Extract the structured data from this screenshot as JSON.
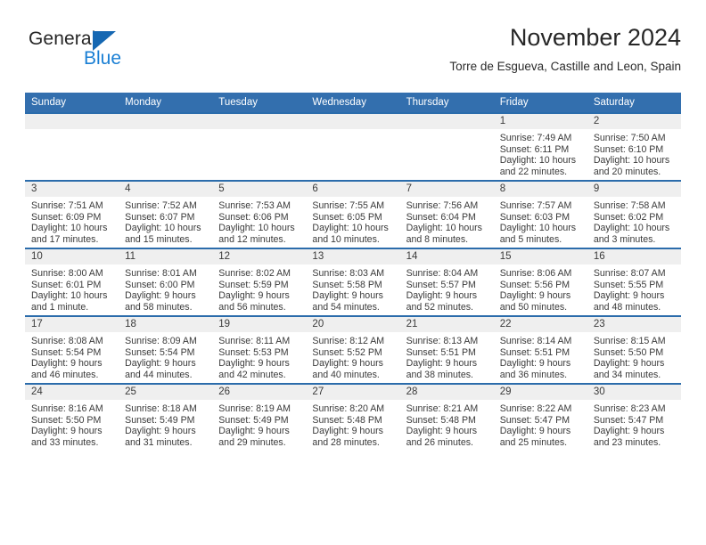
{
  "brand": {
    "line1": "General",
    "line2": "Blue",
    "triangle_color": "#1567b2",
    "blue_color": "#1a7fd4"
  },
  "header": {
    "title": "November 2024",
    "subtitle": "Torre de Esgueva, Castille and Leon, Spain"
  },
  "colors": {
    "header_bar": "#336fae",
    "row_divider": "#2b6cab",
    "daynum_band": "#efefef"
  },
  "weekdays": [
    "Sunday",
    "Monday",
    "Tuesday",
    "Wednesday",
    "Thursday",
    "Friday",
    "Saturday"
  ],
  "weeks": [
    [
      {
        "day": "",
        "blank": true
      },
      {
        "day": "",
        "blank": true
      },
      {
        "day": "",
        "blank": true
      },
      {
        "day": "",
        "blank": true
      },
      {
        "day": "",
        "blank": true
      },
      {
        "day": "1",
        "sunrise": "Sunrise: 7:49 AM",
        "sunset": "Sunset: 6:11 PM",
        "daylight": "Daylight: 10 hours and 22 minutes."
      },
      {
        "day": "2",
        "sunrise": "Sunrise: 7:50 AM",
        "sunset": "Sunset: 6:10 PM",
        "daylight": "Daylight: 10 hours and 20 minutes."
      }
    ],
    [
      {
        "day": "3",
        "sunrise": "Sunrise: 7:51 AM",
        "sunset": "Sunset: 6:09 PM",
        "daylight": "Daylight: 10 hours and 17 minutes."
      },
      {
        "day": "4",
        "sunrise": "Sunrise: 7:52 AM",
        "sunset": "Sunset: 6:07 PM",
        "daylight": "Daylight: 10 hours and 15 minutes."
      },
      {
        "day": "5",
        "sunrise": "Sunrise: 7:53 AM",
        "sunset": "Sunset: 6:06 PM",
        "daylight": "Daylight: 10 hours and 12 minutes."
      },
      {
        "day": "6",
        "sunrise": "Sunrise: 7:55 AM",
        "sunset": "Sunset: 6:05 PM",
        "daylight": "Daylight: 10 hours and 10 minutes."
      },
      {
        "day": "7",
        "sunrise": "Sunrise: 7:56 AM",
        "sunset": "Sunset: 6:04 PM",
        "daylight": "Daylight: 10 hours and 8 minutes."
      },
      {
        "day": "8",
        "sunrise": "Sunrise: 7:57 AM",
        "sunset": "Sunset: 6:03 PM",
        "daylight": "Daylight: 10 hours and 5 minutes."
      },
      {
        "day": "9",
        "sunrise": "Sunrise: 7:58 AM",
        "sunset": "Sunset: 6:02 PM",
        "daylight": "Daylight: 10 hours and 3 minutes."
      }
    ],
    [
      {
        "day": "10",
        "sunrise": "Sunrise: 8:00 AM",
        "sunset": "Sunset: 6:01 PM",
        "daylight": "Daylight: 10 hours and 1 minute."
      },
      {
        "day": "11",
        "sunrise": "Sunrise: 8:01 AM",
        "sunset": "Sunset: 6:00 PM",
        "daylight": "Daylight: 9 hours and 58 minutes."
      },
      {
        "day": "12",
        "sunrise": "Sunrise: 8:02 AM",
        "sunset": "Sunset: 5:59 PM",
        "daylight": "Daylight: 9 hours and 56 minutes."
      },
      {
        "day": "13",
        "sunrise": "Sunrise: 8:03 AM",
        "sunset": "Sunset: 5:58 PM",
        "daylight": "Daylight: 9 hours and 54 minutes."
      },
      {
        "day": "14",
        "sunrise": "Sunrise: 8:04 AM",
        "sunset": "Sunset: 5:57 PM",
        "daylight": "Daylight: 9 hours and 52 minutes."
      },
      {
        "day": "15",
        "sunrise": "Sunrise: 8:06 AM",
        "sunset": "Sunset: 5:56 PM",
        "daylight": "Daylight: 9 hours and 50 minutes."
      },
      {
        "day": "16",
        "sunrise": "Sunrise: 8:07 AM",
        "sunset": "Sunset: 5:55 PM",
        "daylight": "Daylight: 9 hours and 48 minutes."
      }
    ],
    [
      {
        "day": "17",
        "sunrise": "Sunrise: 8:08 AM",
        "sunset": "Sunset: 5:54 PM",
        "daylight": "Daylight: 9 hours and 46 minutes."
      },
      {
        "day": "18",
        "sunrise": "Sunrise: 8:09 AM",
        "sunset": "Sunset: 5:54 PM",
        "daylight": "Daylight: 9 hours and 44 minutes."
      },
      {
        "day": "19",
        "sunrise": "Sunrise: 8:11 AM",
        "sunset": "Sunset: 5:53 PM",
        "daylight": "Daylight: 9 hours and 42 minutes."
      },
      {
        "day": "20",
        "sunrise": "Sunrise: 8:12 AM",
        "sunset": "Sunset: 5:52 PM",
        "daylight": "Daylight: 9 hours and 40 minutes."
      },
      {
        "day": "21",
        "sunrise": "Sunrise: 8:13 AM",
        "sunset": "Sunset: 5:51 PM",
        "daylight": "Daylight: 9 hours and 38 minutes."
      },
      {
        "day": "22",
        "sunrise": "Sunrise: 8:14 AM",
        "sunset": "Sunset: 5:51 PM",
        "daylight": "Daylight: 9 hours and 36 minutes."
      },
      {
        "day": "23",
        "sunrise": "Sunrise: 8:15 AM",
        "sunset": "Sunset: 5:50 PM",
        "daylight": "Daylight: 9 hours and 34 minutes."
      }
    ],
    [
      {
        "day": "24",
        "sunrise": "Sunrise: 8:16 AM",
        "sunset": "Sunset: 5:50 PM",
        "daylight": "Daylight: 9 hours and 33 minutes."
      },
      {
        "day": "25",
        "sunrise": "Sunrise: 8:18 AM",
        "sunset": "Sunset: 5:49 PM",
        "daylight": "Daylight: 9 hours and 31 minutes."
      },
      {
        "day": "26",
        "sunrise": "Sunrise: 8:19 AM",
        "sunset": "Sunset: 5:49 PM",
        "daylight": "Daylight: 9 hours and 29 minutes."
      },
      {
        "day": "27",
        "sunrise": "Sunrise: 8:20 AM",
        "sunset": "Sunset: 5:48 PM",
        "daylight": "Daylight: 9 hours and 28 minutes."
      },
      {
        "day": "28",
        "sunrise": "Sunrise: 8:21 AM",
        "sunset": "Sunset: 5:48 PM",
        "daylight": "Daylight: 9 hours and 26 minutes."
      },
      {
        "day": "29",
        "sunrise": "Sunrise: 8:22 AM",
        "sunset": "Sunset: 5:47 PM",
        "daylight": "Daylight: 9 hours and 25 minutes."
      },
      {
        "day": "30",
        "sunrise": "Sunrise: 8:23 AM",
        "sunset": "Sunset: 5:47 PM",
        "daylight": "Daylight: 9 hours and 23 minutes."
      }
    ]
  ]
}
